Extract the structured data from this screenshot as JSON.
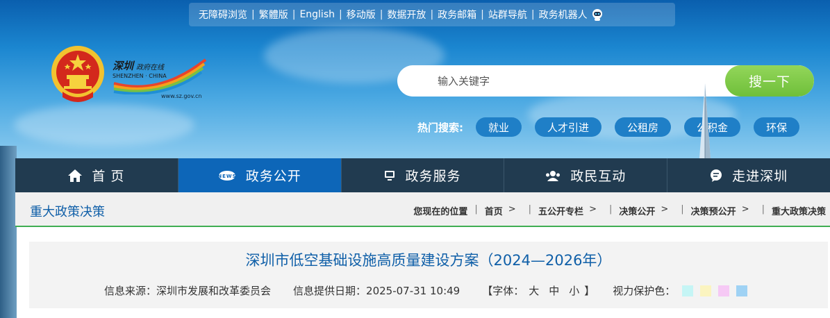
{
  "topbar": {
    "links": [
      "无障碍浏览",
      "繁體版",
      "English",
      "移动版",
      "数据开放",
      "政务邮箱",
      "站群导航",
      "政务机器人"
    ],
    "robot_icon": "robot-icon"
  },
  "brand": {
    "emblem_icon": "national-emblem-icon",
    "logo_icon": "shenzhen-government-logo",
    "url": "www.sz.gov.cn"
  },
  "search": {
    "placeholder": "输入关键字",
    "button_label": "搜一下"
  },
  "hot_search": {
    "label": "热门搜索:",
    "tags": [
      "就业",
      "人才引进",
      "公租房",
      "公积金",
      "环保"
    ]
  },
  "nav": {
    "items": [
      {
        "label": "首 页",
        "icon": "home-icon"
      },
      {
        "label": "政务公开",
        "icon": "news-icon"
      },
      {
        "label": "政务服务",
        "icon": "monitor-icon"
      },
      {
        "label": "政民互动",
        "icon": "users-icon"
      },
      {
        "label": "走进深圳",
        "icon": "chat-bubble-icon"
      }
    ],
    "active_index": 1
  },
  "breadcrumb": {
    "section_title": "重大政策决策",
    "location_label": "您现在的位置",
    "items": [
      "首页",
      "五公开专栏",
      "决策公开",
      "决策预公开",
      "重大政策决策"
    ]
  },
  "article": {
    "title": "深圳市低空基础设施高质量建设方案（2024—2026年）",
    "source_label": "信息来源：",
    "source_value": "深圳市发展和改革委员会",
    "date_label": "信息提供日期：",
    "date_value": "2025-07-31 10:49",
    "font_open": "【字体：",
    "font_large": "大",
    "font_medium": "中",
    "font_small": "小",
    "font_close": "】",
    "eye_label": "视力保护色：",
    "eye_colors": [
      "#c5f5f5",
      "#fbf4c0",
      "#f6c9f5",
      "#9fd2f4"
    ]
  },
  "colors": {
    "nav_bg": "#213b50",
    "nav_active": "#0d66b8",
    "search_button": "#7cc646",
    "title_blue": "#0f5fa8",
    "breadcrumb_rule": "#3fae52"
  }
}
